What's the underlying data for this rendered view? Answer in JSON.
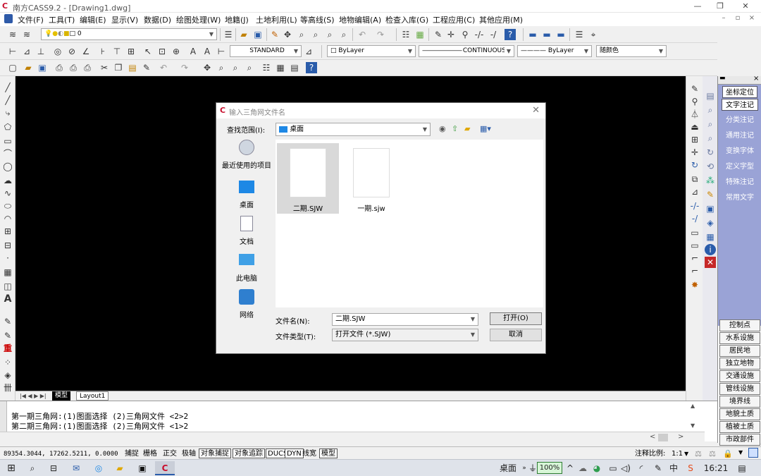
{
  "window": {
    "title": "南方CASS9.2 - [Drawing1.dwg]",
    "controls": [
      "—",
      "❐",
      "✕"
    ]
  },
  "menu": [
    "文件(F)",
    "工具(T)",
    "编辑(E)",
    "显示(V)",
    "数据(D)",
    "绘图处理(W)",
    "地籍(J)",
    "土地利用(L)",
    "等高线(S)",
    "地物编辑(A)",
    "检查入库(G)",
    "工程应用(C)",
    "其他应用(M)"
  ],
  "toolbar": {
    "layer_combo": "0",
    "text_style": "STANDARD",
    "color_combo": "ByLayer",
    "linetype_combo": "CONTINUOUS",
    "lineweight_combo": "ByLayer",
    "plotstyle_combo": "随颜色"
  },
  "dialog": {
    "title": "输入三角网文件名",
    "lookin_label": "查找范围(I):",
    "lookin_value": "桌面",
    "places": [
      "最近使用的项目",
      "桌面",
      "文档",
      "此电脑",
      "网络"
    ],
    "files": [
      {
        "name": "二期.SJW",
        "selected": true
      },
      {
        "name": "一期.sjw",
        "selected": false
      }
    ],
    "filename_label": "文件名(N):",
    "filename_value": "二期.SJW",
    "filetype_label": "文件类型(T):",
    "filetype_value": "打开文件 (*.SJW)",
    "open_button": "打开(O)",
    "cancel_button": "取消"
  },
  "layout_tabs": [
    "模型",
    "Layout1"
  ],
  "right_panel": {
    "items": [
      "坐标定位",
      "文字注记",
      "分类注记",
      "通用注记",
      "变换字体",
      "定义字型",
      "特殊注记",
      "常用文字"
    ],
    "buttons": [
      "控制点",
      "水系设施",
      "居民地",
      "独立地物",
      "交通设施",
      "管线设施",
      "境界线",
      "地貌土质",
      "植被土质",
      "市政部件"
    ]
  },
  "command": {
    "line1": "第一期三角网:(1)图面选择 (2)三角网文件 <2>2",
    "line2": "第二期三角网:(1)图面选择 (2)三角网文件 <1>2"
  },
  "status": {
    "coords": "89354.3044, 17262.5211, 0.0000",
    "toggles": [
      "捕捉",
      "栅格",
      "正交",
      "极轴",
      "对象捕捉",
      "对象追踪",
      "DUCS",
      "DYN",
      "线宽",
      "模型"
    ],
    "scale_label": "注释比例:",
    "scale_value": "1:1"
  },
  "taskbar": {
    "desktop_label": "桌面",
    "battery": "100%",
    "time": "16:21"
  },
  "colors": {
    "canvas": "#000000",
    "panel_blue": "#9aa3d6",
    "app_red": "#c8102e"
  }
}
